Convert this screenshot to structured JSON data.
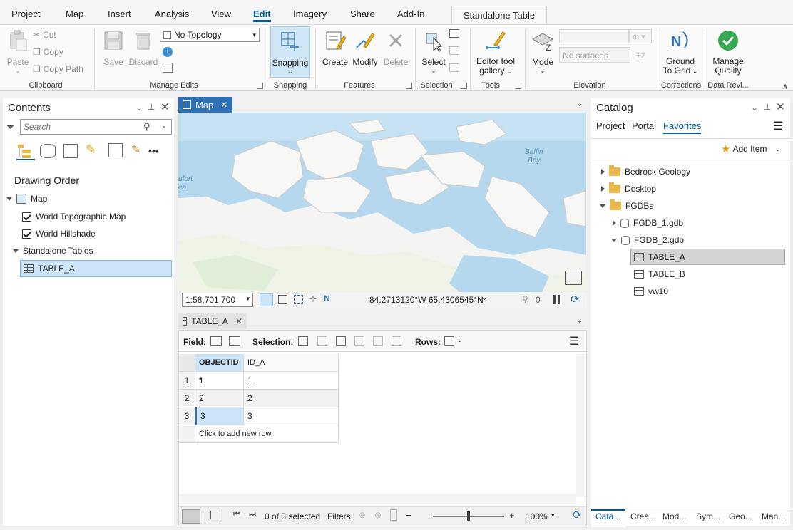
{
  "ribbon_tabs": [
    "Project",
    "Map",
    "Insert",
    "Analysis",
    "View",
    "Edit",
    "Imagery",
    "Share",
    "Add-In"
  ],
  "active_tab": "Edit",
  "contextual_tab": "Standalone Table",
  "clipboard": {
    "paste": "Paste",
    "cut": "Cut",
    "copy": "Copy",
    "copy_path": "Copy Path",
    "label": "Clipboard"
  },
  "manage_edits": {
    "save": "Save",
    "discard": "Discard",
    "topology": "No Topology",
    "label": "Manage Edits"
  },
  "snapping": {
    "button": "Snapping",
    "label": "Snapping"
  },
  "features": {
    "create": "Create",
    "modify": "Modify",
    "delete": "Delete",
    "label": "Features"
  },
  "selection": {
    "select": "Select",
    "label": "Selection"
  },
  "tools": {
    "gallery_line1": "Editor tool",
    "gallery_line2": "gallery",
    "label": "Tools"
  },
  "elevation": {
    "mode": "Mode",
    "surfaces": "No surfaces",
    "unit": "m",
    "label": "Elevation"
  },
  "corrections": {
    "ground_line1": "Ground",
    "ground_line2": "To Grid",
    "label": "Corrections"
  },
  "data_review": {
    "manage_line1": "Manage",
    "manage_line2": "Quality",
    "label": "Data Revi..."
  },
  "contents": {
    "title": "Contents",
    "search_placeholder": "Search",
    "drawing_order": "Drawing Order",
    "items": [
      {
        "label": "Map"
      },
      {
        "label": "World Topographic Map"
      },
      {
        "label": "World Hillshade"
      },
      {
        "label": "Standalone Tables"
      },
      {
        "label": "TABLE_A"
      }
    ]
  },
  "map_view": {
    "tab": "Map",
    "scale": "1:58,701,700",
    "coordinates": "84.2713120°W 65.4306545°N",
    "label_baffin_1": "Baffin",
    "label_baffin_2": "Bay",
    "label_beaufort_1": "ufort",
    "label_beaufort_2": "ea",
    "pause_count": "0"
  },
  "table_view": {
    "tab": "TABLE_A",
    "field_label": "Field:",
    "selection_label": "Selection:",
    "rows_label": "Rows:",
    "columns": [
      "OBJECTID *",
      "ID_A"
    ],
    "rows": [
      {
        "n": "1",
        "objectid": "1",
        "id_a": "1"
      },
      {
        "n": "2",
        "objectid": "2",
        "id_a": "2"
      },
      {
        "n": "3",
        "objectid": "3",
        "id_a": "3"
      }
    ],
    "add_row": "Click to add new row.",
    "selected_status": "0 of 3 selected",
    "filters_label": "Filters:",
    "zoom": "100%"
  },
  "catalog": {
    "title": "Catalog",
    "tabs": [
      "Project",
      "Portal",
      "Favorites"
    ],
    "active_tab": "Favorites",
    "add_item": "Add Item",
    "tree": [
      {
        "label": "Bedrock Geology"
      },
      {
        "label": "Desktop"
      },
      {
        "label": "FGDBs"
      },
      {
        "label": "FGDB_1.gdb"
      },
      {
        "label": "FGDB_2.gdb"
      },
      {
        "label": "TABLE_A"
      },
      {
        "label": "TABLE_B"
      },
      {
        "label": "vw10"
      }
    ],
    "bottom_tabs": [
      "Cata...",
      "Crea...",
      "Mod...",
      "Sym...",
      "Geo...",
      "Man..."
    ]
  },
  "colors": {
    "accent": "#005e95",
    "selected_row": "#cce4f7",
    "snapping_active": "#cfe6f7",
    "map_water": "#b6d8ee",
    "map_land": "#f4f4f2"
  }
}
